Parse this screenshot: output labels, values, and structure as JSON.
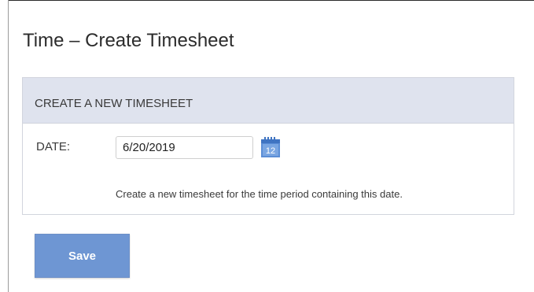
{
  "page": {
    "title": "Time – Create Timesheet"
  },
  "panel": {
    "header": "CREATE A NEW TIMESHEET",
    "date_label": "DATE:",
    "date_value": "6/20/2019",
    "calendar_day": "12",
    "calendar_icon": "calendar-icon",
    "helper_text": "Create a new timesheet for the time period containing this date."
  },
  "actions": {
    "save_label": "Save"
  },
  "colors": {
    "header_bg": "#dfe3ee",
    "button_bg": "#6e96d3",
    "calendar_blue": "#5b8ed6"
  }
}
